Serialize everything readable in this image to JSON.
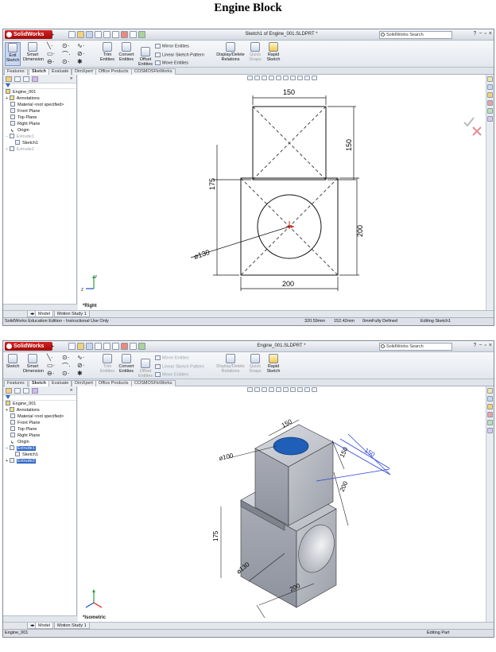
{
  "page_title": "Engine Block",
  "windows": [
    {
      "app_logo_text": "SolidWorks",
      "window_title": "Sketch1 of Engine_001.SLDPRT *",
      "search_placeholder": "SolidWorks Search",
      "help": "?",
      "ribbon": {
        "exit_sketch": "Exit Sketch",
        "smart_dimension": "Smart Dimension",
        "trim_entities": "Trim Entities",
        "convert_entities": "Convert Entities",
        "offset_entities": "Offset Entities",
        "mirror_entities": "Mirror Entities",
        "linear_sketch_pattern": "Linear Sketch Pattern",
        "move_entities": "Move Entities",
        "display_delete_relations": "Display/Delete Relations",
        "quick_snaps": "Quick Snaps",
        "rapid_sketch": "Rapid Sketch"
      },
      "tabs": [
        "Features",
        "Sketch",
        "Evaluate",
        "DimXpert",
        "Office Products",
        "COSMOSFloWorks"
      ],
      "selected_tab": "Sketch",
      "tree": [
        "Engine_001",
        "Annotations",
        "Material <not specified>",
        "Front Plane",
        "Top Plane",
        "Right Plane",
        "Origin",
        "Extrude1",
        "Sketch1",
        "Extrude2"
      ],
      "view_label": "*Right",
      "dims": {
        "top_width": "150",
        "top_height": "150",
        "left_height": "175",
        "right_height": "200",
        "bottom_width": "200",
        "diameter": "⌀130"
      },
      "bottom_tabs": [
        "Model",
        "Motion Study 1"
      ],
      "status": {
        "left": "SolidWorks Education Edition - Instructional Use Only",
        "x": "320.59mm",
        "y": "152.42mm",
        "z": "0mm",
        "defined": "Fully Defined",
        "mode": "Editing Sketch1"
      }
    },
    {
      "app_logo_text": "SolidWorks",
      "window_title": "Engine_001.SLDPRT *",
      "search_placeholder": "SolidWorks Search",
      "help": "?",
      "ribbon": {
        "exit_sketch": "Sketch",
        "smart_dimension": "Smart Dimension",
        "trim_entities": "Trim Entities",
        "convert_entities": "Convert Entities",
        "offset_entities": "Offset Entities",
        "mirror_entities": "Mirror Entities",
        "linear_sketch_pattern": "Linear Sketch Pattern",
        "move_entities": "Move Entities",
        "display_delete_relations": "Display/Delete Relations",
        "quick_snaps": "Quick Snaps",
        "rapid_sketch": "Rapid Sketch"
      },
      "tabs": [
        "Features",
        "Sketch",
        "Evaluate",
        "DimXpert",
        "Office Products",
        "COSMOSFloWorks"
      ],
      "selected_tab": "Sketch",
      "tree": [
        "Engine_001",
        "Annotations",
        "Material <not specified>",
        "Front Plane",
        "Top Plane",
        "Right Plane",
        "Origin",
        "Extrude1",
        "Sketch1",
        "Extrude2"
      ],
      "view_label": "*Isometric",
      "dims": {
        "top_width": "150",
        "top_height": "150",
        "left_height": "175",
        "right_height": "200",
        "bottom_width": "200",
        "diameter": "⌀130",
        "depth": "150",
        "diameter_top": "⌀100"
      },
      "bottom_tabs": [
        "Model",
        "Motion Study 1"
      ],
      "status": {
        "left": "Engine_001",
        "mode": "Editing Part"
      }
    }
  ],
  "colors": {
    "hole_fill": "#1f5fb7",
    "selection": "#3569c6",
    "logo_red": "#c41818",
    "body_grey": "#b9bcc4"
  }
}
